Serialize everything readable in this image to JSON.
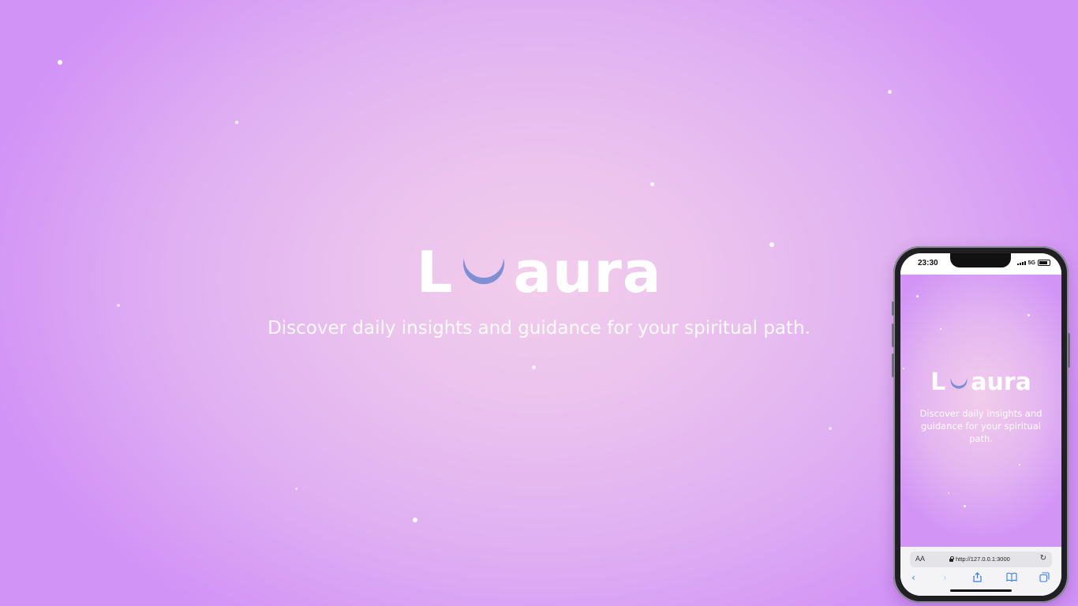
{
  "brand": {
    "logo_prefix": "L",
    "logo_suffix": "aura",
    "moon_icon": "crescent-moon-icon",
    "moon_color": "#7e8fd4",
    "tagline": "Discover daily insights and guidance for your spiritual path."
  },
  "colors": {
    "background_center": "#f2cdeb",
    "background_edge": "#d293f6",
    "text": "#ffffff",
    "link_blue": "#2f7cf6"
  },
  "phone": {
    "status": {
      "time": "23:30",
      "network": "5G"
    },
    "browser": {
      "reader_label": "AA",
      "url": "http://127.0.0.1:3000",
      "icons": [
        "reload-icon",
        "back-icon",
        "forward-icon",
        "share-icon",
        "bookmarks-icon",
        "tabs-icon"
      ]
    }
  }
}
